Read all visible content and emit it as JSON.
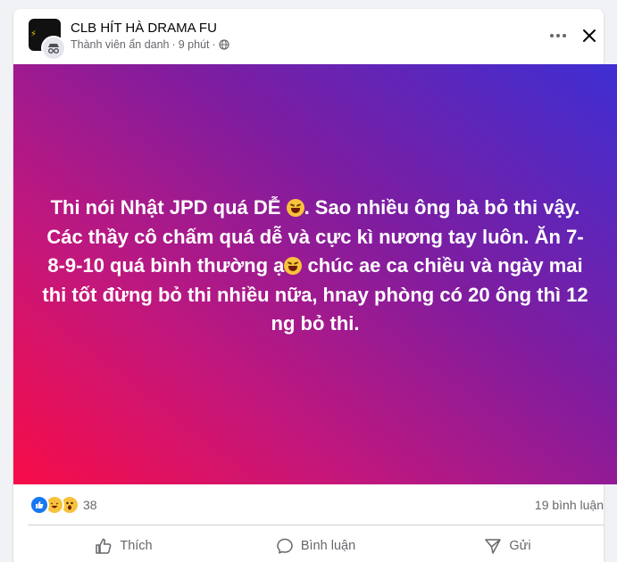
{
  "post": {
    "group_name": "CLB HÍT HÀ DRAMA FU",
    "author": "Thành viên ẩn danh",
    "separator": "·",
    "time": "9 phút",
    "text_parts": [
      "Thi nói Nhật JPD quá DỄ ",
      ". Sao nhiều ông bà bỏ thi vậy. Các thầy cô chấm quá dễ và cực kì nương tay luôn. Ăn 7-8-9-10 quá bình thường ạ",
      " chúc ae ca chiều và ngày mai thi tốt đừng bỏ thi nhiều nữa, hnay phòng có 20 ông thì 12 ng bỏ thi."
    ],
    "emoji": "rolling-on-floor-laughing",
    "background_gradient": [
      "#f70c47",
      "#c3177c",
      "#7e1da0",
      "#3e2ed2"
    ]
  },
  "reactions": {
    "types": [
      "like",
      "haha",
      "wow"
    ],
    "count": "38",
    "comments": "19 bình luận"
  },
  "actions": {
    "like": "Thích",
    "comment": "Bình luận",
    "share": "Gửi"
  },
  "icons": {
    "more": "more-horizontal-icon",
    "close": "close-icon",
    "privacy": "globe-icon"
  },
  "colors": {
    "like_blue": "#1877f2",
    "secondary_text": "#65676b"
  }
}
